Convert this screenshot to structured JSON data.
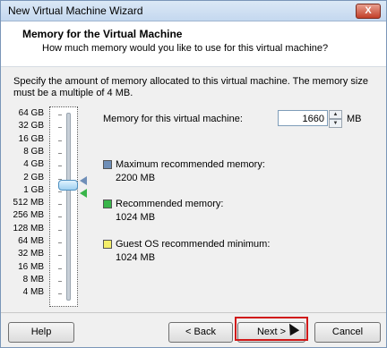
{
  "window": {
    "title": "New Virtual Machine Wizard",
    "close_label": "X"
  },
  "header": {
    "title": "Memory for the Virtual Machine",
    "subtitle": "How much memory would you like to use for this virtual machine?"
  },
  "intro": "Specify the amount of memory allocated to this virtual machine. The memory size must be a multiple of 4 MB.",
  "slider": {
    "labels": [
      "64 GB",
      "32 GB",
      "16 GB",
      "8 GB",
      "4 GB",
      "2 GB",
      "1 GB",
      "512 MB",
      "256 MB",
      "128 MB",
      "64 MB",
      "32 MB",
      "16 MB",
      "8 MB",
      "4 MB"
    ]
  },
  "memory": {
    "label": "Memory for this virtual machine:",
    "value": "1660",
    "unit": "MB"
  },
  "legend": {
    "max": {
      "label": "Maximum recommended memory:",
      "value": "2200 MB",
      "color": "#6f8fb8"
    },
    "rec": {
      "label": "Recommended memory:",
      "value": "1024 MB",
      "color": "#39b54a"
    },
    "min": {
      "label": "Guest OS recommended minimum:",
      "value": "1024 MB",
      "color": "#f4ee6a"
    }
  },
  "buttons": {
    "help": "Help",
    "back": "< Back",
    "next": "Next >",
    "cancel": "Cancel"
  }
}
